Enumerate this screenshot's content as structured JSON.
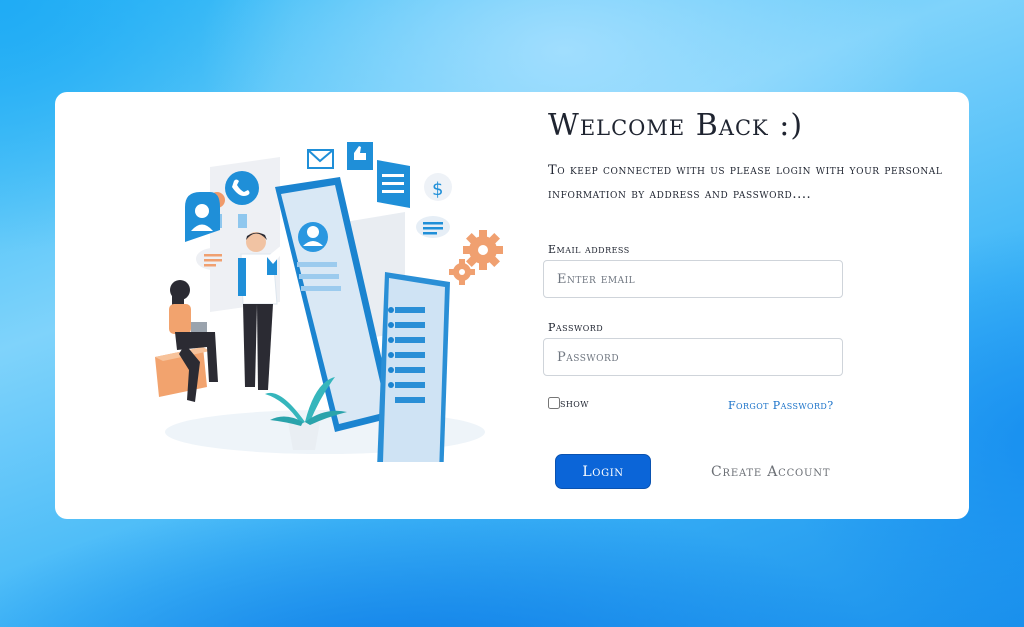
{
  "login": {
    "title": "Welcome Back :)",
    "subtitle": "To keep connected with us please login with your personal information by address and password....",
    "email_label": "Email address",
    "email_placeholder": "Enter email",
    "email_value": "",
    "password_label": "Password",
    "password_placeholder": "Password",
    "password_value": "",
    "show_label": "show",
    "show_checked": false,
    "forgot_label": "Forgot Password?",
    "login_button": "Login",
    "create_account": "Create Account"
  },
  "colors": {
    "primary_button": "#0b65d8",
    "link": "#1a72c9",
    "illustration_blue": "#1f8fd8",
    "illustration_orange": "#f0a070"
  }
}
